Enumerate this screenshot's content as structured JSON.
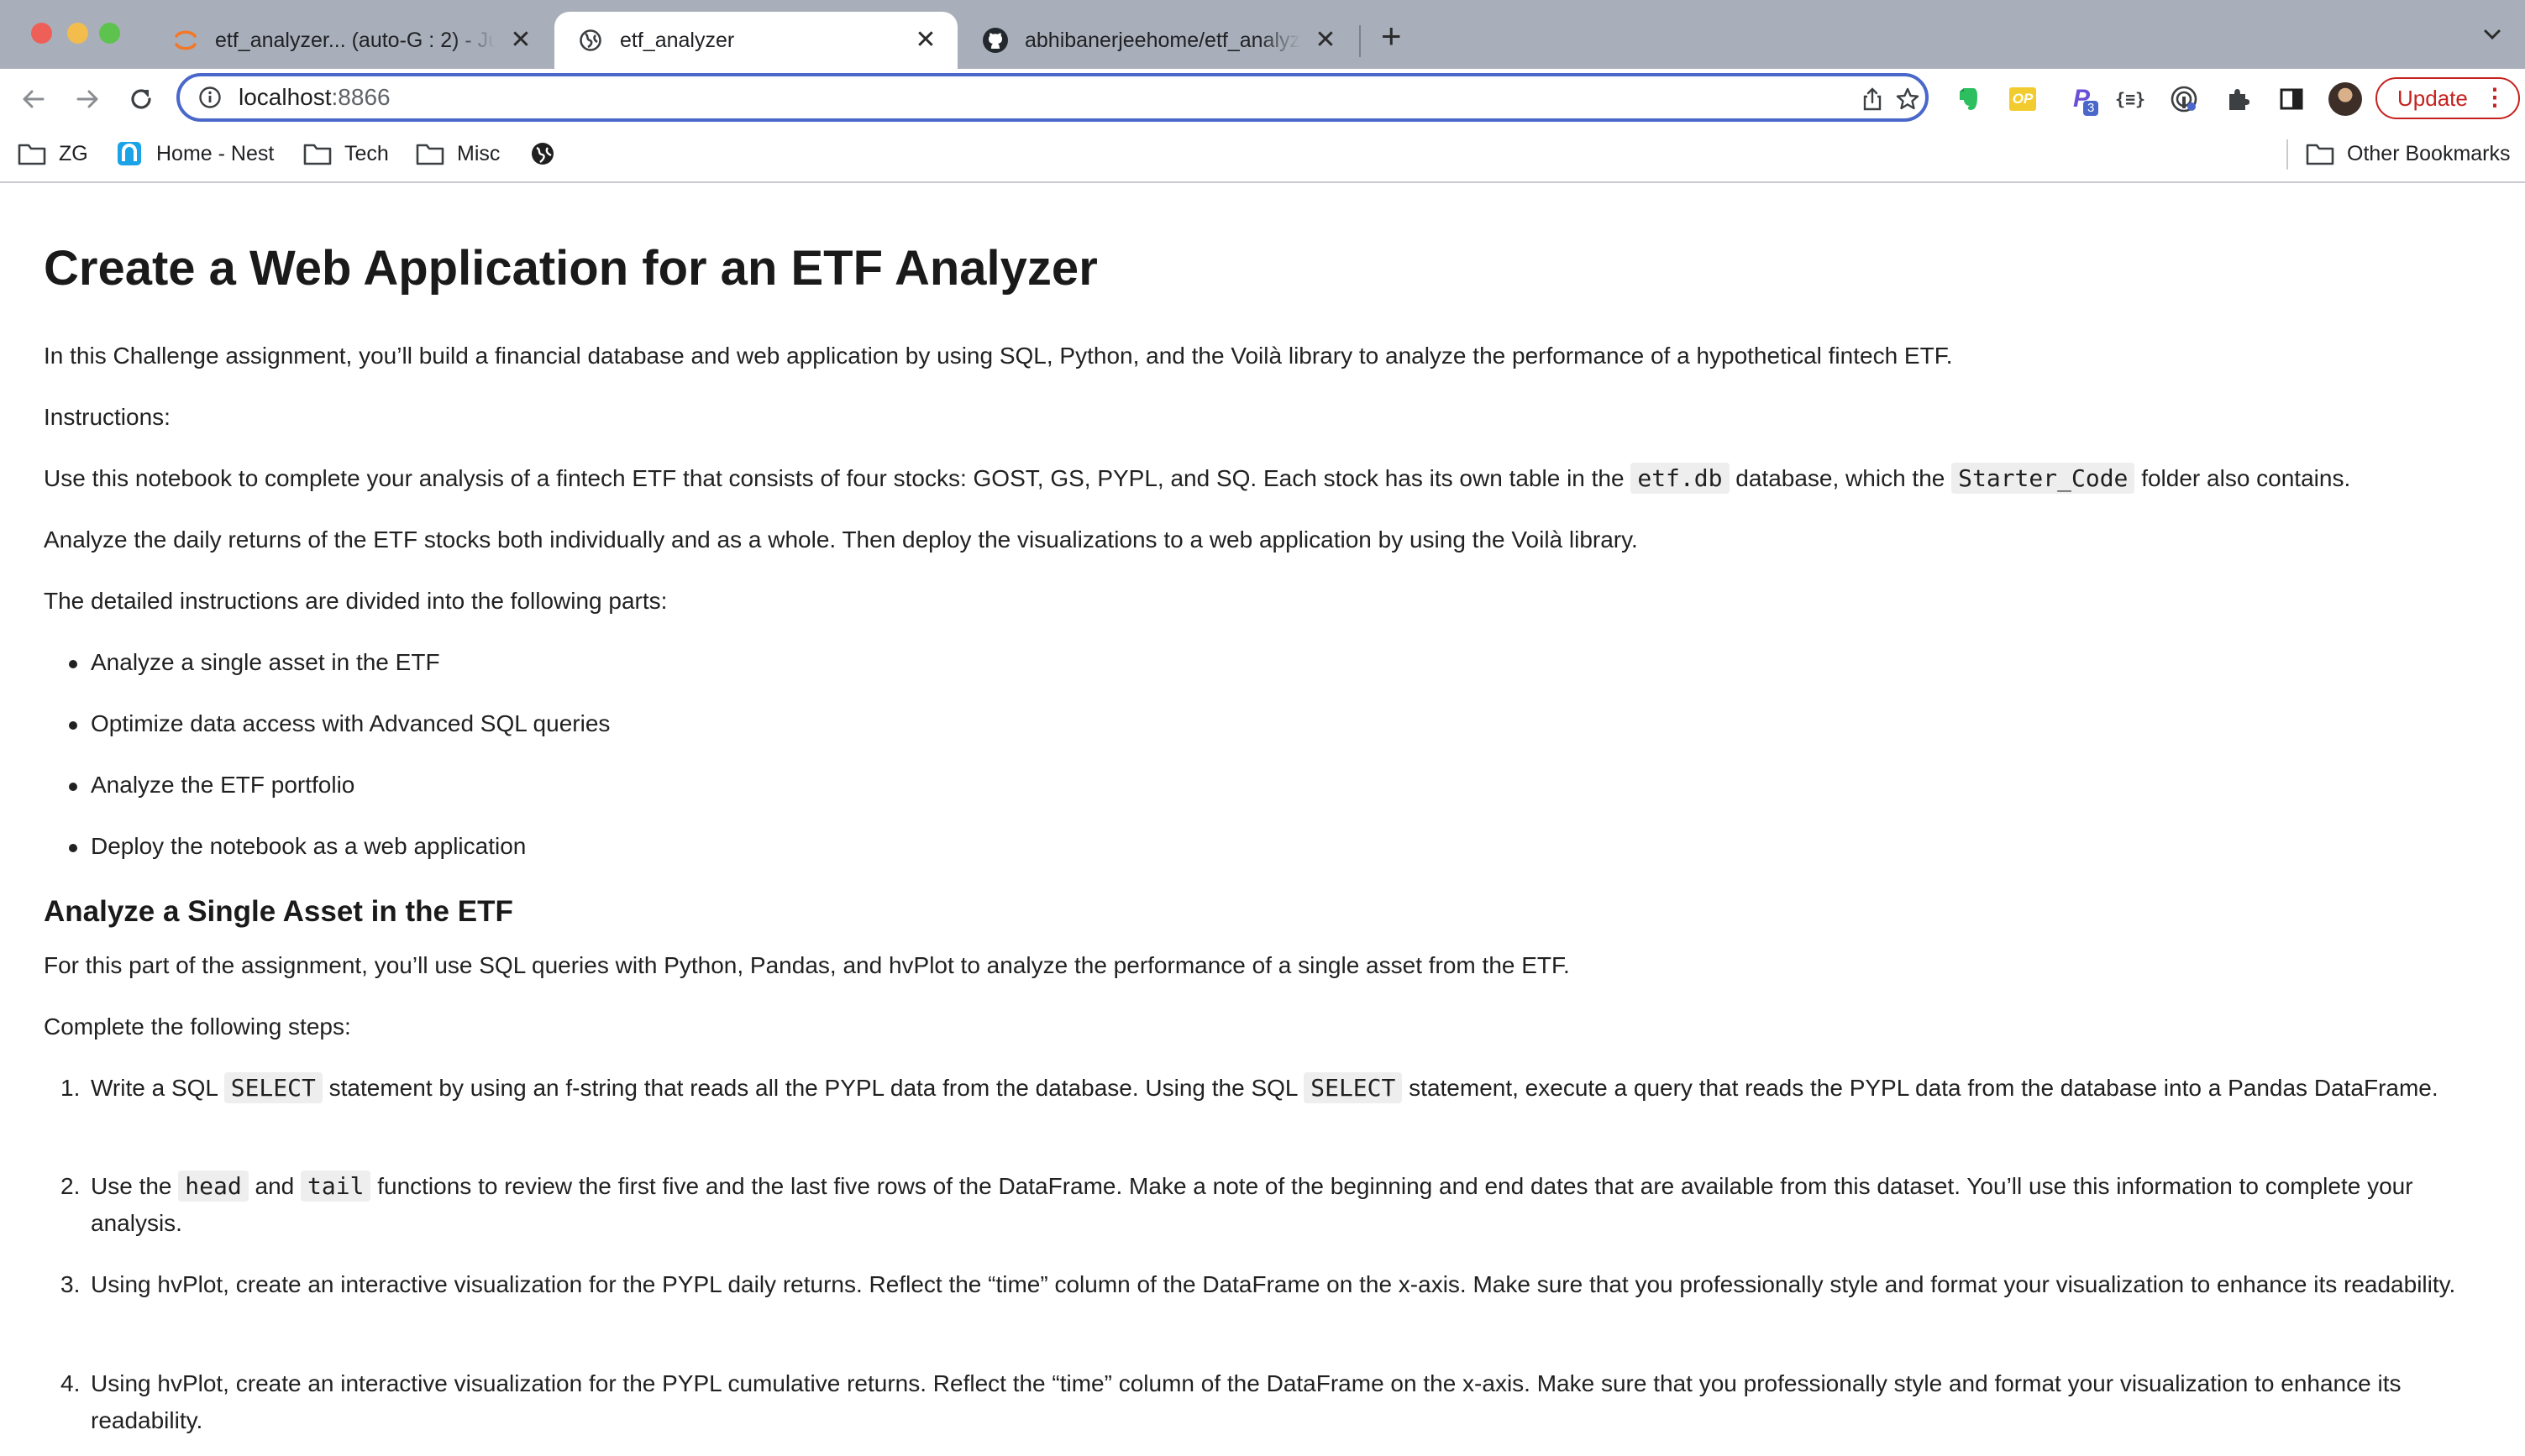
{
  "browser": {
    "tabs": [
      {
        "title": "etf_analyzer... (auto-G : 2) - Ju",
        "icon": "jupyter-icon",
        "active": false
      },
      {
        "title": "etf_analyzer",
        "icon": "globe-icon",
        "active": true
      },
      {
        "title": "abhibanerjeehome/etf_analyze",
        "icon": "github-icon",
        "active": false
      }
    ],
    "new_tab": "+",
    "close_glyph": "✕",
    "address": {
      "host": "localhost",
      "port": ":8866"
    },
    "update_label": "Update",
    "update_dots": "⋮",
    "update_color": "#c5221f",
    "omnibox_border_color": "#4a68c9",
    "bookmarks": [
      {
        "label": "ZG",
        "icon": "folder-icon"
      },
      {
        "label": "Home - Nest",
        "icon": "nest-icon"
      },
      {
        "label": "Tech",
        "icon": "folder-icon"
      },
      {
        "label": "Misc",
        "icon": "folder-icon"
      },
      {
        "label": "",
        "icon": "globe-icon"
      }
    ],
    "other_bookmarks": "Other Bookmarks",
    "extensions": [
      "evernote-icon",
      "op-icon",
      "p-extension-icon",
      "json-icon",
      "password-icon",
      "puzzle-icon",
      "sidebar-icon"
    ],
    "extension_badge": "3",
    "op_label": "OP",
    "p_label": "P"
  },
  "notebook": {
    "title": "Create a Web Application for an ETF Analyzer",
    "intro": "In this Challenge assignment, you’ll build a financial database and web application by using SQL, Python, and the Voilà library to analyze the performance of a hypothetical fintech ETF.",
    "instructions_label": "Instructions:",
    "use_notebook": {
      "part1": "Use this notebook to complete your analysis of a fintech ETF that consists of four stocks: GOST, GS, PYPL, and SQ. Each stock has its own table in the ",
      "code1": "etf.db",
      "part2": " database, which the ",
      "code2": "Starter_Code",
      "part3": " folder also contains."
    },
    "analyze_daily": "Analyze the daily returns of the ETF stocks both individually and as a whole. Then deploy the visualizations to a web application by using the Voilà library.",
    "parts_intro": "The detailed instructions are divided into the following parts:",
    "parts": [
      "Analyze a single asset in the ETF",
      "Optimize data access with Advanced SQL queries",
      "Analyze the ETF portfolio",
      "Deploy the notebook as a web application"
    ],
    "section_title": "Analyze a Single Asset in the ETF",
    "section_intro": "For this part of the assignment, you’ll use SQL queries with Python, Pandas, and hvPlot to analyze the performance of a single asset from the ETF.",
    "steps_intro": "Complete the following steps:",
    "steps": [
      {
        "num": "1.",
        "a": "Write a SQL ",
        "code_a": "SELECT",
        "b": " statement by using an f-string that reads all the PYPL data from the database. Using the SQL ",
        "code_b": "SELECT",
        "c": " statement, execute a query that reads the PYPL data from the database into a Pandas DataFrame."
      },
      {
        "num": "2.",
        "a": "Use the ",
        "code_a": "head",
        "b": " and ",
        "code_b": "tail",
        "c": " functions to review the first five and the last five rows of the DataFrame. Make a note of the beginning and end dates that are available from this dataset. You’ll use this information to complete your analysis."
      },
      {
        "num": "3.",
        "text": "Using hvPlot, create an interactive visualization for the PYPL daily returns. Reflect the “time” column of the DataFrame on the x-axis. Make sure that you professionally style and format your visualization to enhance its readability."
      },
      {
        "num": "4.",
        "text": "Using hvPlot, create an interactive visualization for the PYPL cumulative returns. Reflect the “time” column of the DataFrame on the x-axis. Make sure that you professionally style and format your visualization to enhance its readability."
      }
    ]
  }
}
